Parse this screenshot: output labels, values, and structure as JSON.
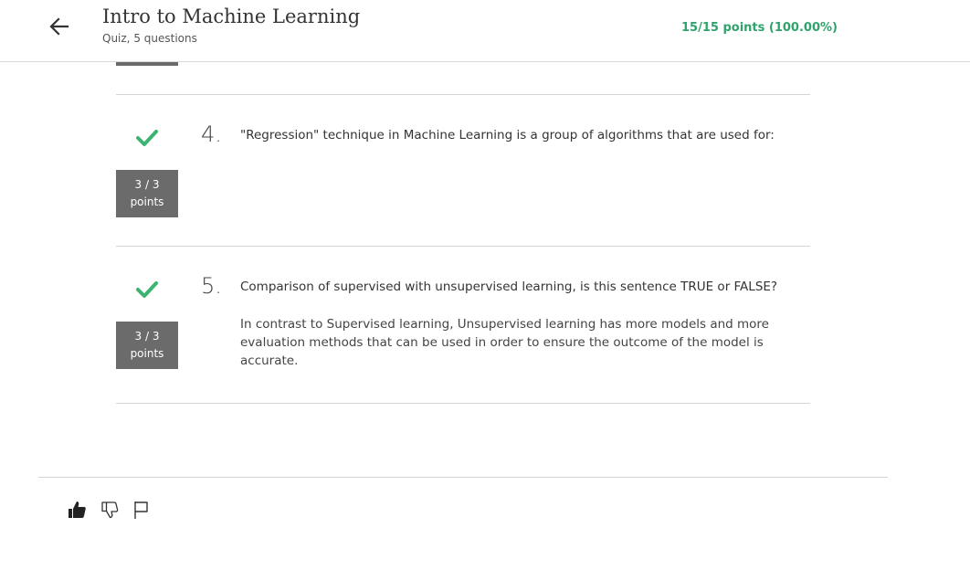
{
  "header": {
    "title": "Intro to Machine Learning",
    "subtitle": "Quiz, 5 questions",
    "score": "15/15 points (100.00%)"
  },
  "questions": [
    {
      "number": "4.",
      "text": "\"Regression\" technique in Machine Learning is a group of algorithms that are used for:",
      "points_value": "3 / 3",
      "points_label": "points",
      "status": "correct"
    },
    {
      "number": "5.",
      "text": "Comparison of supervised with unsupervised learning, is this sentence TRUE or FALSE?",
      "detail": "In contrast to Supervised learning, Unsupervised learning has more models and more evaluation methods that can be used in order to ensure the outcome of the model is accurate.",
      "points_value": "3 / 3",
      "points_label": "points",
      "status": "correct"
    }
  ],
  "feedback": {
    "icons": [
      "thumbs-up-icon",
      "thumbs-down-icon",
      "flag-icon"
    ]
  },
  "colors": {
    "accent_green": "#2ea36b",
    "badge_gray": "#6b6b6b",
    "check_green": "#3cb371"
  }
}
